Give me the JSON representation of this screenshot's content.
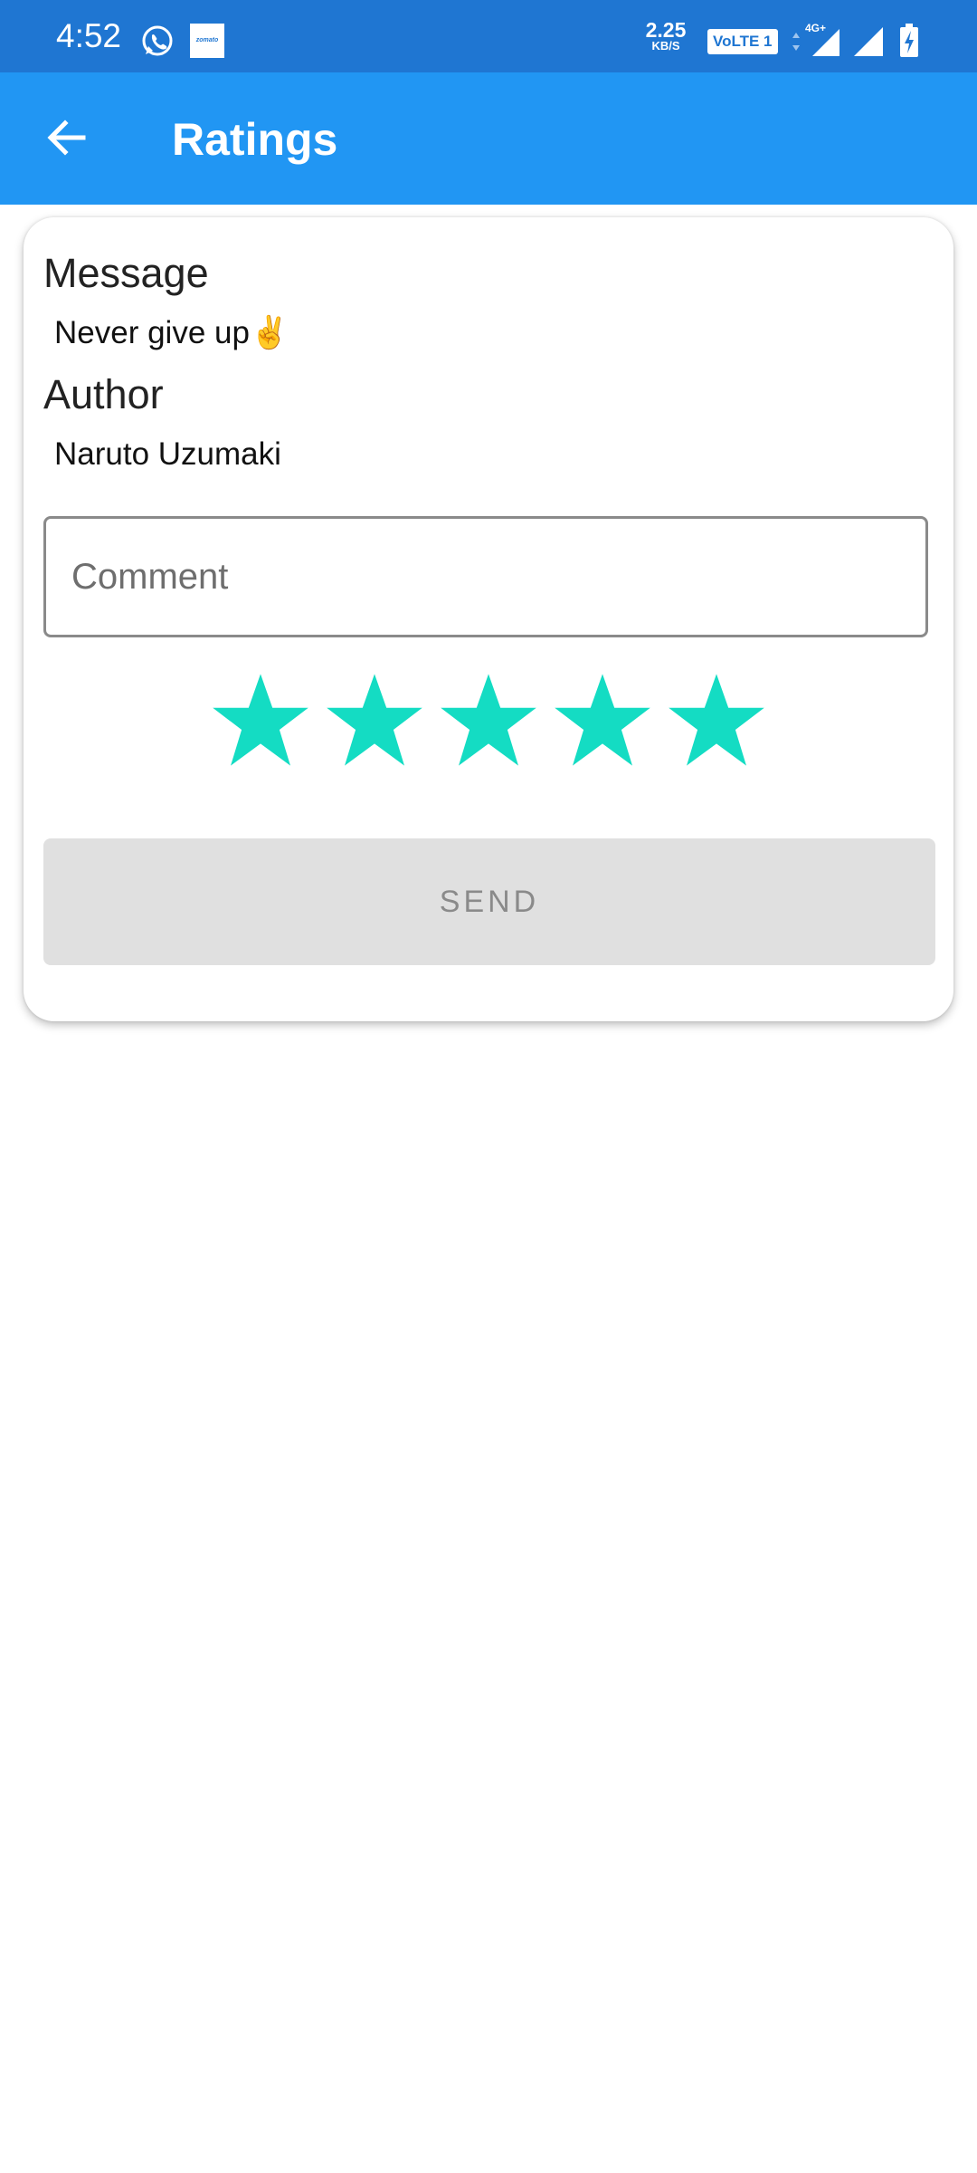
{
  "status_bar": {
    "time": "4:52",
    "net_speed_value": "2.25",
    "net_speed_unit": "KB/S",
    "volte_label": "VoLTE 1",
    "network_type": "4G+",
    "zomato_label": "zomato",
    "icons": [
      "whatsapp-icon",
      "zomato-icon",
      "network-arrows-icon",
      "signal-icon",
      "signal-icon",
      "battery-charging-icon"
    ],
    "bar_color": "#1f76d2"
  },
  "app_bar": {
    "title": "Ratings",
    "back_icon": "arrow-left-icon",
    "color": "#2196f3"
  },
  "card": {
    "message_label": "Message",
    "message_value": "Never give up✌️",
    "author_label": "Author",
    "author_value": "Naruto Uzumaki",
    "comment_placeholder": "Comment",
    "comment_value": "",
    "rating": {
      "value": 5,
      "max": 5,
      "star_color": "#14dcc3"
    },
    "send_label": "SEND"
  }
}
